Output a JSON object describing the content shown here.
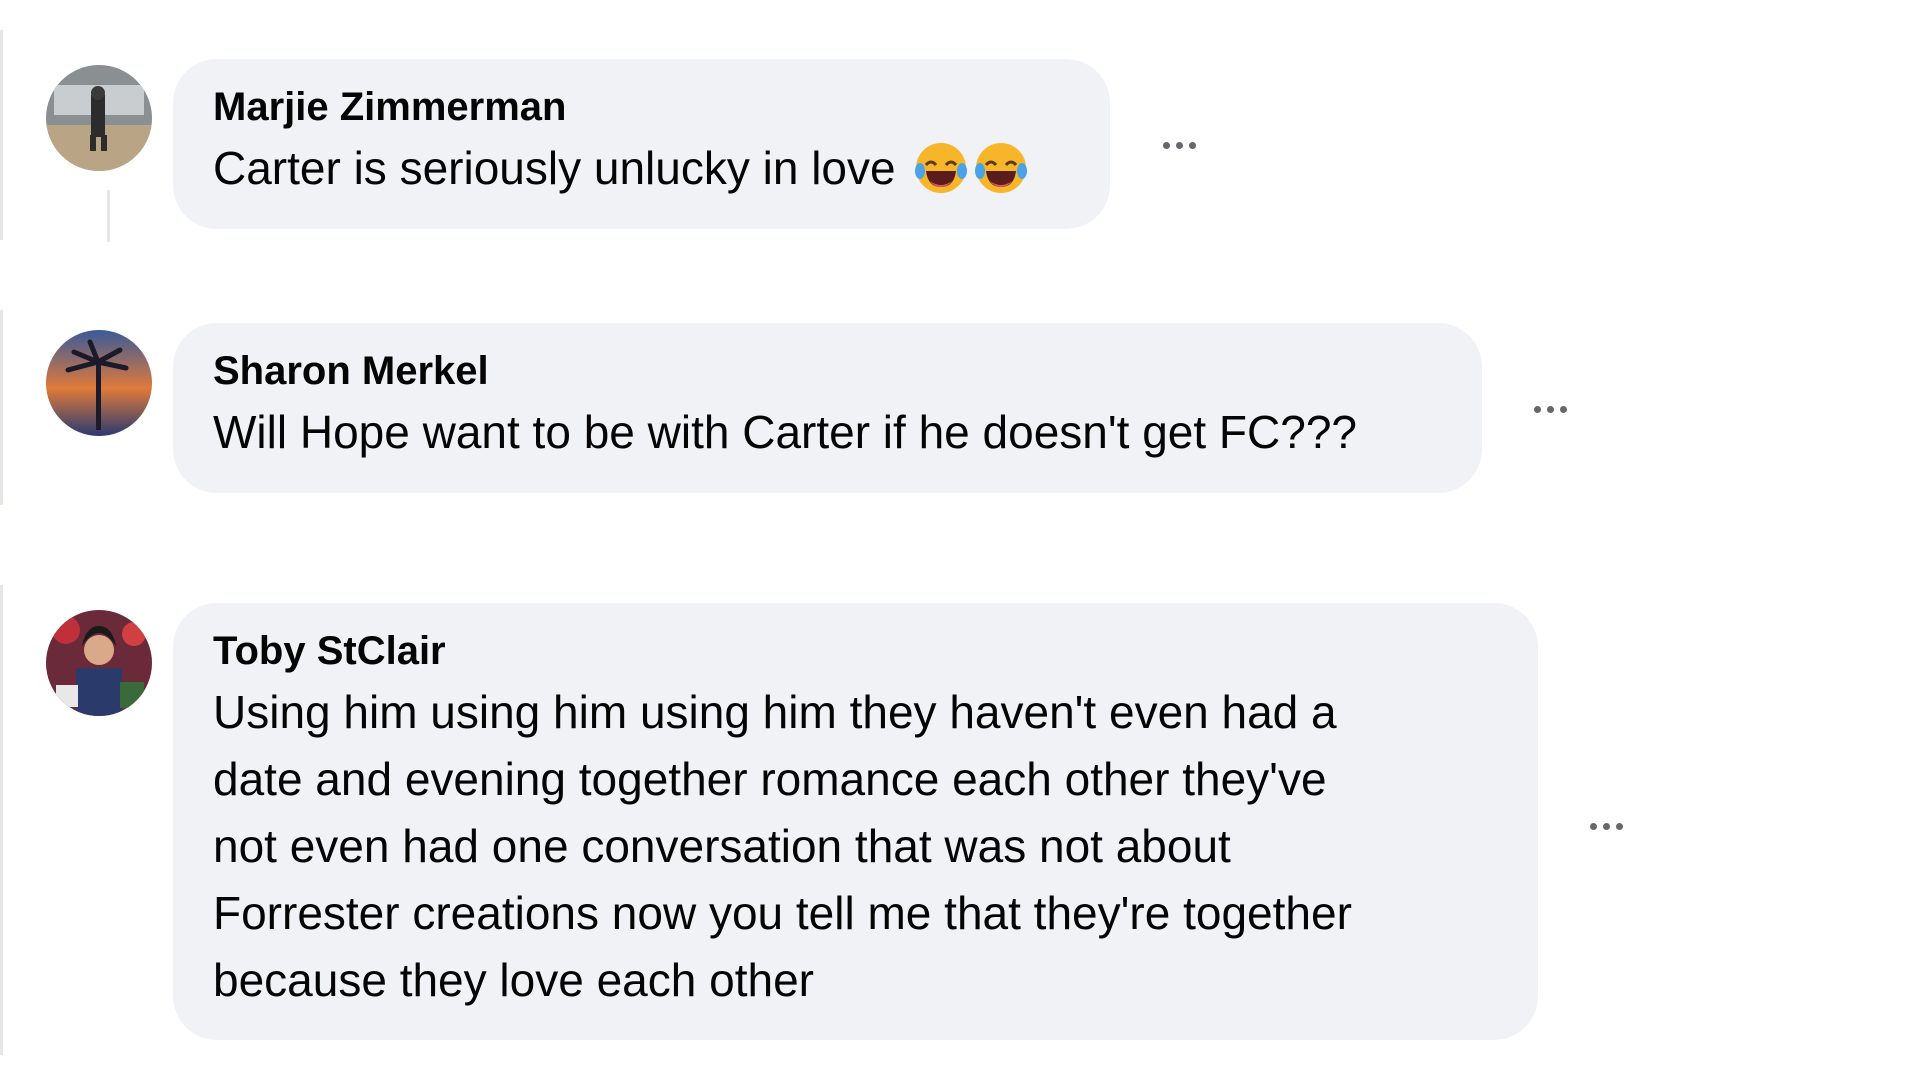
{
  "comments": [
    {
      "author": "Marjie Zimmerman",
      "text": "Carter is seriously unlucky in love",
      "emojis": [
        "laughing-tears-emoji",
        "laughing-tears-emoji"
      ],
      "avatar_icon": "user-avatar-photo"
    },
    {
      "author": "Sharon Merkel",
      "text": "Will Hope want to be with Carter if he doesn't get FC???",
      "avatar_icon": "user-avatar-photo"
    },
    {
      "author": "Toby StClair",
      "text_lines": [
        "Using him using him using him they haven't even had a",
        "date and evening together romance each other they've",
        "not even had one conversation that was not about",
        "Forrester creations now you tell me that they're together",
        "because they love each other"
      ],
      "avatar_icon": "user-avatar-photo"
    }
  ],
  "more_icon": "more-options-icon",
  "colors": {
    "bubble": "#f0f2f5",
    "text": "#050505",
    "muted": "#65676b",
    "thread": "#e4e6eb"
  }
}
